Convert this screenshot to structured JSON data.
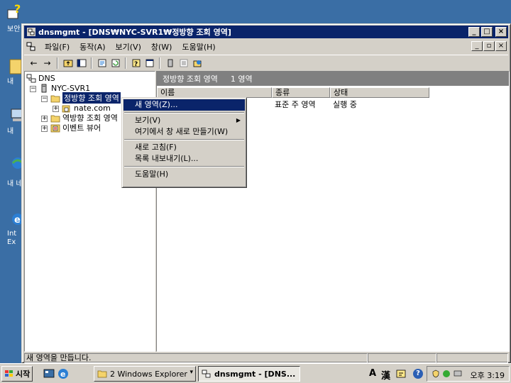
{
  "desktop": {
    "icon_labels": [
      "보안",
      "내",
      "내 ",
      "내 네",
      "Int",
      "Ex"
    ]
  },
  "window": {
    "title": "dnsmgmt - [DNS₩NYC-SVR1₩정방향 조회 영역]",
    "caption_buttons": {
      "minimize": "_",
      "restore": "□",
      "close": "×"
    },
    "child_buttons": {
      "minimize": "_",
      "restore": "▫",
      "close": "×"
    }
  },
  "menubar": {
    "items": [
      "파일(F)",
      "동작(A)",
      "보기(V)",
      "창(W)",
      "도움말(H)"
    ]
  },
  "toolbar": {
    "back": "←",
    "forward": "→"
  },
  "tree": {
    "root": "DNS",
    "server": "NYC-SVR1",
    "forward_zones": "정방향 조회 영역",
    "zone_nate": "nate.com",
    "reverse_zones": "역방향 조회 영역",
    "event_viewer": "이벤트 뷰어"
  },
  "right_pane": {
    "header_title": "정방향 조회 영역",
    "header_count": "1 영역",
    "columns": [
      "이름",
      "종류",
      "상태"
    ],
    "rows": [
      {
        "name": "",
        "type": "표준 주 영역",
        "status": "실행 중"
      }
    ]
  },
  "context_menu": {
    "items": [
      {
        "label": "새 영역(Z)...",
        "highlighted": true
      },
      {
        "separator": true
      },
      {
        "label": "보기(V)",
        "submenu": true
      },
      {
        "label": "여기에서 창 새로 만들기(W)"
      },
      {
        "separator": true
      },
      {
        "label": "새로 고침(F)"
      },
      {
        "label": "목록 내보내기(L)..."
      },
      {
        "separator": true
      },
      {
        "label": "도움말(H)"
      }
    ],
    "submenu_arrow": "▶"
  },
  "statusbar": {
    "text": "새 영역을 만듭니다."
  },
  "taskbar": {
    "start_label": "시작",
    "buttons": [
      {
        "label": "2 Windows Explorer",
        "dropdown": "▾"
      },
      {
        "label": "dnsmgmt - [DNS..."
      }
    ],
    "ime": {
      "mode": "A",
      "hanja": "漢"
    },
    "help": "?",
    "clock": "오후 3:19"
  },
  "colors": {
    "desktop": "#3a6ea5",
    "titlebar": "#0a246a",
    "face": "#d4d0c8",
    "selection": "#0a246a"
  }
}
